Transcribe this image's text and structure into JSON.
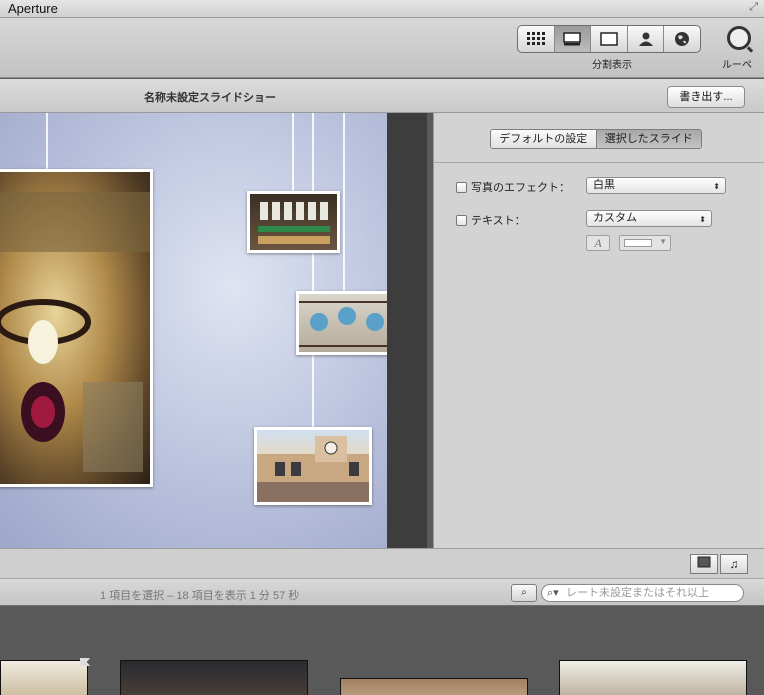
{
  "app": {
    "title": "Aperture"
  },
  "toolbar": {
    "view_buttons": [
      {
        "icon": "grid-icon",
        "active": false
      },
      {
        "icon": "viewer-icon",
        "active": true
      },
      {
        "icon": "fullscreen-view-icon",
        "active": false
      },
      {
        "icon": "faces-icon",
        "active": false
      },
      {
        "icon": "places-globe-icon",
        "active": false
      }
    ],
    "view_label": "分割表示",
    "loupe_label": "ルーペ"
  },
  "header": {
    "title": "名称未設定スライドショー",
    "export_label": "書き出す..."
  },
  "inspector": {
    "scope_tabs": [
      {
        "label": "デフォルトの設定",
        "active": false
      },
      {
        "label": "選択したスライド",
        "active": true
      }
    ],
    "photo_effect": {
      "label": "写真のエフェクト：",
      "value": "白黒"
    },
    "text": {
      "label": "テキスト：",
      "value": "カスタム"
    },
    "font_button": "A"
  },
  "status": {
    "text": "1 項目を選択 – 18 項目を表示 1 分 57 秒",
    "search_placeholder": "レート未設定またはそれ以上"
  },
  "colors": {
    "accent": "#6f6f6f",
    "preview_bg": "#b8c0dc",
    "strip": "#3d3d3d"
  }
}
